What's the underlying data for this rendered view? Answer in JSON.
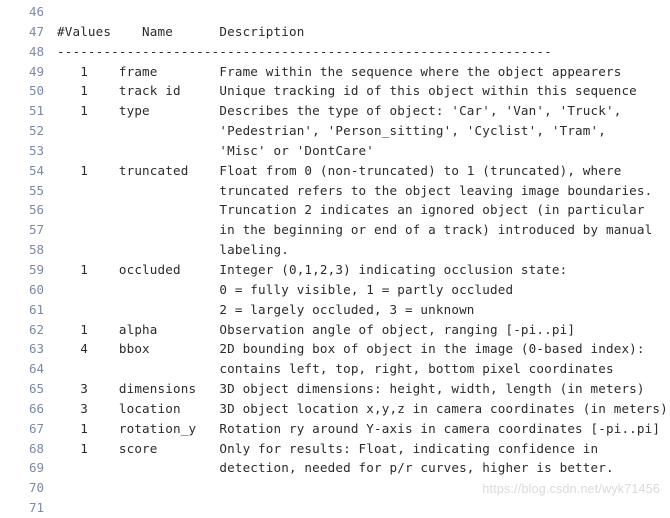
{
  "editor": {
    "background_color": "#ffffff",
    "text_color": "#2b2b2b",
    "line_number_color": "#7a8aa8",
    "first_line_number": 46,
    "last_line_number": 71
  },
  "watermark": {
    "text": "https://blog.csdn.net/wyk71456",
    "color": "#d9d9de"
  },
  "columns": {
    "values_header": "#Values",
    "name_header": "Name",
    "description_header": "Description"
  },
  "lines": [
    {
      "number": "46",
      "text": ""
    },
    {
      "number": "47",
      "text": "#Values    Name      Description"
    },
    {
      "number": "48",
      "text": "----------------------------------------------------------------"
    },
    {
      "number": "49",
      "text": "   1    frame        Frame within the sequence where the object appearers"
    },
    {
      "number": "50",
      "text": "   1    track id     Unique tracking id of this object within this sequence"
    },
    {
      "number": "51",
      "text": "   1    type         Describes the type of object: 'Car', 'Van', 'Truck',"
    },
    {
      "number": "52",
      "text": "                     'Pedestrian', 'Person_sitting', 'Cyclist', 'Tram',"
    },
    {
      "number": "53",
      "text": "                     'Misc' or 'DontCare'"
    },
    {
      "number": "54",
      "text": "   1    truncated    Float from 0 (non-truncated) to 1 (truncated), where"
    },
    {
      "number": "55",
      "text": "                     truncated refers to the object leaving image boundaries."
    },
    {
      "number": "56",
      "text": "                     Truncation 2 indicates an ignored object (in particular"
    },
    {
      "number": "57",
      "text": "                     in the beginning or end of a track) introduced by manual"
    },
    {
      "number": "58",
      "text": "                     labeling."
    },
    {
      "number": "59",
      "text": "   1    occluded     Integer (0,1,2,3) indicating occlusion state:"
    },
    {
      "number": "60",
      "text": "                     0 = fully visible, 1 = partly occluded"
    },
    {
      "number": "61",
      "text": "                     2 = largely occluded, 3 = unknown"
    },
    {
      "number": "62",
      "text": "   1    alpha        Observation angle of object, ranging [-pi..pi]"
    },
    {
      "number": "63",
      "text": "   4    bbox         2D bounding box of object in the image (0-based index):"
    },
    {
      "number": "64",
      "text": "                     contains left, top, right, bottom pixel coordinates"
    },
    {
      "number": "65",
      "text": "   3    dimensions   3D object dimensions: height, width, length (in meters)"
    },
    {
      "number": "66",
      "text": "   3    location     3D object location x,y,z in camera coordinates (in meters)"
    },
    {
      "number": "67",
      "text": "   1    rotation_y   Rotation ry around Y-axis in camera coordinates [-pi..pi]"
    },
    {
      "number": "68",
      "text": "   1    score        Only for results: Float, indicating confidence in"
    },
    {
      "number": "69",
      "text": "                     detection, needed for p/r curves, higher is better."
    },
    {
      "number": "70",
      "text": ""
    },
    {
      "number": "71",
      "text": ""
    }
  ],
  "fields": [
    {
      "values": "1",
      "name": "frame",
      "description": "Frame within the sequence where the object appearers"
    },
    {
      "values": "1",
      "name": "track id",
      "description": "Unique tracking id of this object within this sequence"
    },
    {
      "values": "1",
      "name": "type",
      "description": "Describes the type of object: 'Car', 'Van', 'Truck', 'Pedestrian', 'Person_sitting', 'Cyclist', 'Tram', 'Misc' or 'DontCare'"
    },
    {
      "values": "1",
      "name": "truncated",
      "description": "Float from 0 (non-truncated) to 1 (truncated), where truncated refers to the object leaving image boundaries. Truncation 2 indicates an ignored object (in particular in the beginning or end of a track) introduced by manual labeling."
    },
    {
      "values": "1",
      "name": "occluded",
      "description": "Integer (0,1,2,3) indicating occlusion state: 0 = fully visible, 1 = partly occluded 2 = largely occluded, 3 = unknown"
    },
    {
      "values": "1",
      "name": "alpha",
      "description": "Observation angle of object, ranging [-pi..pi]"
    },
    {
      "values": "4",
      "name": "bbox",
      "description": "2D bounding box of object in the image (0-based index): contains left, top, right, bottom pixel coordinates"
    },
    {
      "values": "3",
      "name": "dimensions",
      "description": "3D object dimensions: height, width, length (in meters)"
    },
    {
      "values": "3",
      "name": "location",
      "description": "3D object location x,y,z in camera coordinates (in meters)"
    },
    {
      "values": "1",
      "name": "rotation_y",
      "description": "Rotation ry around Y-axis in camera coordinates [-pi..pi]"
    },
    {
      "values": "1",
      "name": "score",
      "description": "Only for results: Float, indicating confidence in detection, needed for p/r curves, higher is better."
    }
  ]
}
